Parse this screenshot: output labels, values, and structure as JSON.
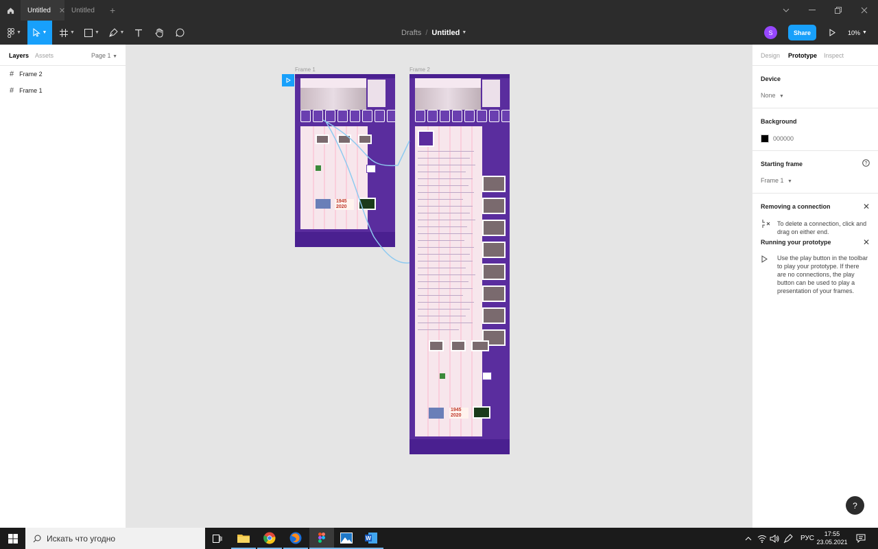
{
  "window": {
    "tabs": [
      {
        "label": "Untitled"
      },
      {
        "label": "Untitled"
      }
    ]
  },
  "toolbar": {
    "breadcrumb_parent": "Drafts",
    "breadcrumb_separator": "/",
    "file_name": "Untitled",
    "avatar_letter": "S",
    "share_label": "Share",
    "zoom": "10%"
  },
  "left_panel": {
    "tab_layers": "Layers",
    "tab_assets": "Assets",
    "page": "Page 1",
    "layers": [
      {
        "label": "Frame 2"
      },
      {
        "label": "Frame 1"
      }
    ]
  },
  "canvas": {
    "frames": [
      {
        "label": "Frame 1"
      },
      {
        "label": "Frame 2"
      }
    ],
    "frame_content_text": [
      "1945",
      "2020"
    ]
  },
  "right_panel": {
    "tab_design": "Design",
    "tab_prototype": "Prototype",
    "tab_inspect": "Inspect",
    "device_title": "Device",
    "device_value": "None",
    "background_title": "Background",
    "background_value": "000000",
    "starting_frame_title": "Starting frame",
    "starting_frame_value": "Frame 1",
    "removing_title": "Removing a connection",
    "removing_text": "To delete a connection, click and drag on either end.",
    "running_title": "Running your prototype",
    "running_text": "Use the play button in the toolbar to play your prototype. If there are no connections, the play button can be used to play a presentation of your frames."
  },
  "help_label": "?",
  "taskbar": {
    "search_placeholder": "Искать что угодно",
    "lang": "РУС",
    "time": "17:55",
    "date": "23.05.2021"
  },
  "colors": {
    "accent": "#18a0fb",
    "toolbar_bg": "#2c2c2c",
    "frame_purple": "#5a2d9e",
    "prototype_link": "#8ecaf0"
  }
}
